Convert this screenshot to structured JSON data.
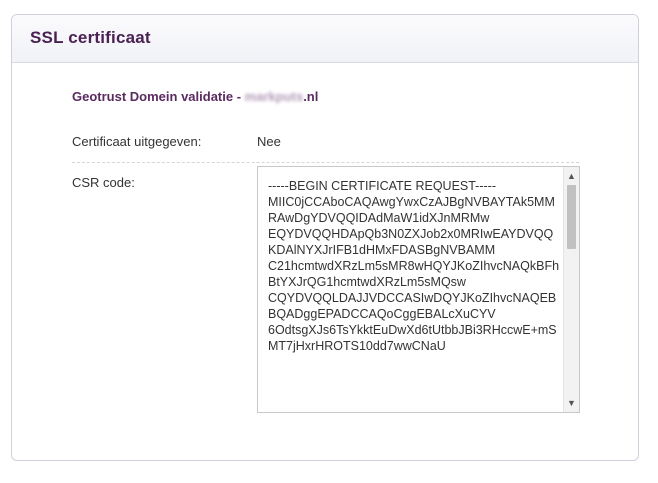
{
  "panel": {
    "title": "SSL certificaat"
  },
  "product": {
    "name": "Geotrust Domein validatie",
    "separator": " - ",
    "domain_blurred": "markputs",
    "domain_tld": ".nl"
  },
  "fields": {
    "issued_label": "Certificaat uitgegeven:",
    "issued_value": "Nee",
    "csr_label": "CSR code:"
  },
  "csr": {
    "text": "-----BEGIN CERTIFICATE REQUEST-----\nMIIC0jCCAboCAQAwgYwxCzAJBgNVBAYTAk5MMRAwDgYDVQQIDAdMaW1idXJnMRMw\nEQYDVQQHDApQb3N0ZXJob2x0MRIwEAYDVQQKDAlNYXJrIFB1dHMxFDASBgNVBAMM\nC21hcmtwdXRzLm5sMR8wHQYJKoZIhvcNAQkBFhBtYXJrQG1hcmtwdXRzLm5sMQsw\nCQYDVQQLDAJJVDCCASIwDQYJKoZIhvcNAQEBBQADggEPADCCAQoCggEBALcXuCYV\n6OdtsgXJs6TsYkktEuDwXd6tUtbbJBi3RHccwE+mSMT7jHxrHROTS10dd7wwCNaU"
  },
  "scrollbar": {
    "up_glyph": "▲",
    "down_glyph": "▼"
  }
}
